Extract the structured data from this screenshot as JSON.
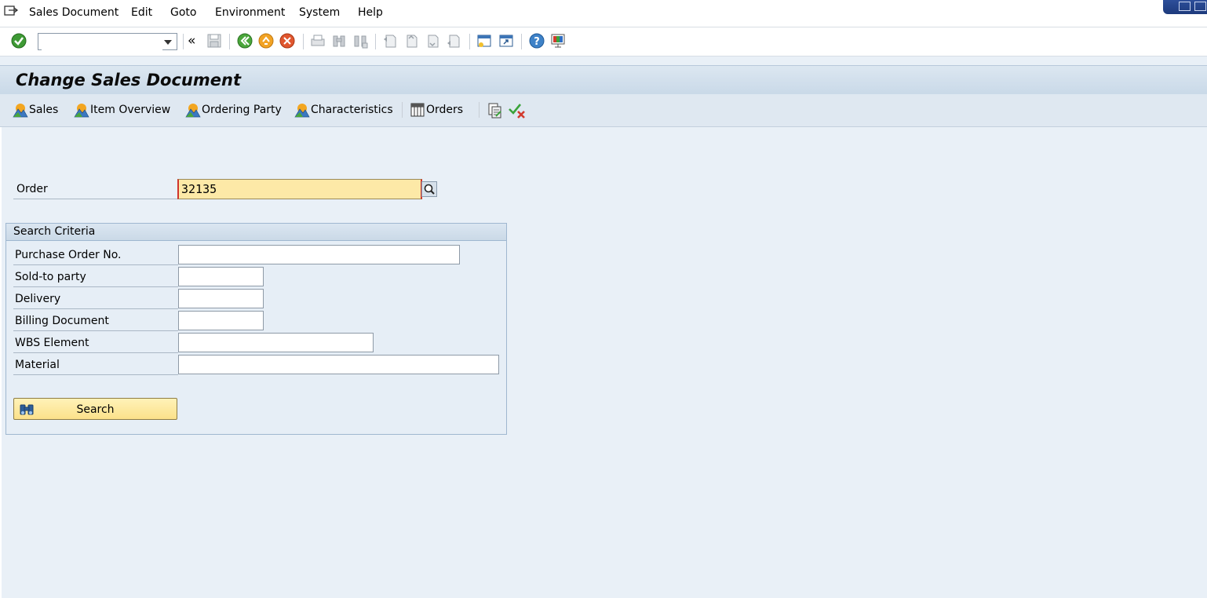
{
  "menu": {
    "items": [
      "Sales Document",
      "Edit",
      "Goto",
      "Environment",
      "System",
      "Help"
    ]
  },
  "toolbar": {
    "command_value": "",
    "back_label": "«"
  },
  "screen": {
    "title": "Change Sales Document"
  },
  "app_toolbar": {
    "buttons": [
      "Sales",
      "Item Overview",
      "Ordering Party",
      "Characteristics",
      "Orders"
    ]
  },
  "order": {
    "label": "Order",
    "value": "32135"
  },
  "search_criteria": {
    "title": "Search Criteria",
    "fields": [
      {
        "label": "Purchase Order No.",
        "value": ""
      },
      {
        "label": "Sold-to party",
        "value": ""
      },
      {
        "label": "Delivery",
        "value": ""
      },
      {
        "label": "Billing Document",
        "value": ""
      },
      {
        "label": "WBS Element",
        "value": ""
      },
      {
        "label": "Material",
        "value": ""
      }
    ],
    "search_label": "Search"
  },
  "colors": {
    "background": "#e9f0f7",
    "required_field": "#fde9a7",
    "button": "#fbe18a"
  }
}
